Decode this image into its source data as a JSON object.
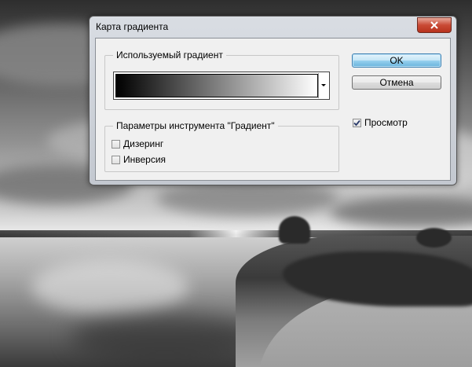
{
  "dialog": {
    "title": "Карта градиента",
    "gradient_group_label": "Используемый градиент",
    "options_group_label": "Параметры инструмента \"Градиент\"",
    "dither_label": "Дизеринг",
    "dither_checked": false,
    "reverse_label": "Инверсия",
    "reverse_checked": false,
    "ok_label": "OK",
    "cancel_label": "Отмена",
    "preview_label": "Просмотр",
    "preview_checked": true,
    "gradient": {
      "from": "#000000",
      "to": "#ffffff"
    }
  },
  "colors": {
    "default_button": "#68b3db",
    "close_button": "#c94a35"
  },
  "icons": {
    "close": "close-icon",
    "dropdown": "dropdown-arrow-icon",
    "check": "checkmark-icon"
  }
}
